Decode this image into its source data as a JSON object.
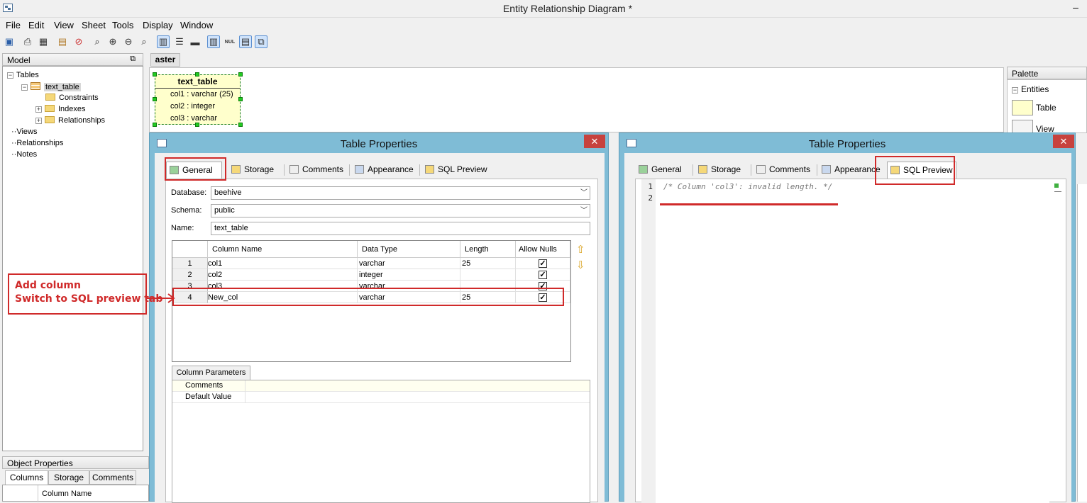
{
  "window": {
    "title": "Entity Relationship Diagram *",
    "minimize_glyph": "–"
  },
  "menu": [
    "File",
    "Edit",
    "View",
    "Sheet",
    "Tools",
    "Display",
    "Window"
  ],
  "model_panel": {
    "title": "Model",
    "tree": {
      "tables": "Tables",
      "table_name": "text_table",
      "children": [
        "Constraints",
        "Indexes",
        "Relationships"
      ],
      "views": "Views",
      "relationships": "Relationships",
      "notes": "Notes"
    }
  },
  "sheet_tab": "aster",
  "entity": {
    "title": "text_table",
    "columns": [
      "col1 : varchar (25)",
      "col2 : integer",
      "col3 : varchar"
    ]
  },
  "palette": {
    "title": "Palette",
    "section": "Entities",
    "items": [
      "Table",
      "View"
    ]
  },
  "object_properties": {
    "title": "Object Properties",
    "tabs": [
      "Columns",
      "Storage",
      "Comments"
    ],
    "column_header": "Column Name"
  },
  "dialog_left": {
    "title": "Table Properties",
    "close": "✕",
    "tabs": [
      "General",
      "Storage",
      "Comments",
      "Appearance",
      "SQL Preview"
    ],
    "database_label": "Database:",
    "database_value": "beehive",
    "schema_label": "Schema:",
    "schema_value": "public",
    "name_label": "Name:",
    "name_value": "text_table",
    "grid_headers": [
      "Column Name",
      "Data Type",
      "Length",
      "Allow Nulls"
    ],
    "rows": [
      {
        "num": "1",
        "name": "col1",
        "type": "varchar",
        "length": "25",
        "nulls": "✓"
      },
      {
        "num": "2",
        "name": "col2",
        "type": "integer",
        "length": "",
        "nulls": "✓"
      },
      {
        "num": "3",
        "name": "col3",
        "type": "varchar",
        "length": "",
        "nulls": "✓"
      },
      {
        "num": "4",
        "name": "New_col",
        "type": "varchar",
        "length": "25",
        "nulls": "✓"
      }
    ],
    "column_params_tab": "Column Parameters",
    "column_params": [
      "Comments",
      "Default Value"
    ]
  },
  "dialog_right": {
    "title": "Table Properties",
    "close": "✕",
    "tabs": [
      "General",
      "Storage",
      "Comments",
      "Appearance",
      "SQL Preview"
    ],
    "line_numbers": [
      "1",
      "2"
    ],
    "code_lines": [
      "/* Column 'col3': invalid length. */",
      ""
    ]
  },
  "annotation": {
    "line1": "Add column",
    "line2": "Switch to SQL preview tab"
  },
  "colors": {
    "annotation_red": "#d02a2a",
    "dialog_frame": "#7fbcd6",
    "entity_fill": "#ffffcc",
    "selection_green": "#22cc22"
  }
}
